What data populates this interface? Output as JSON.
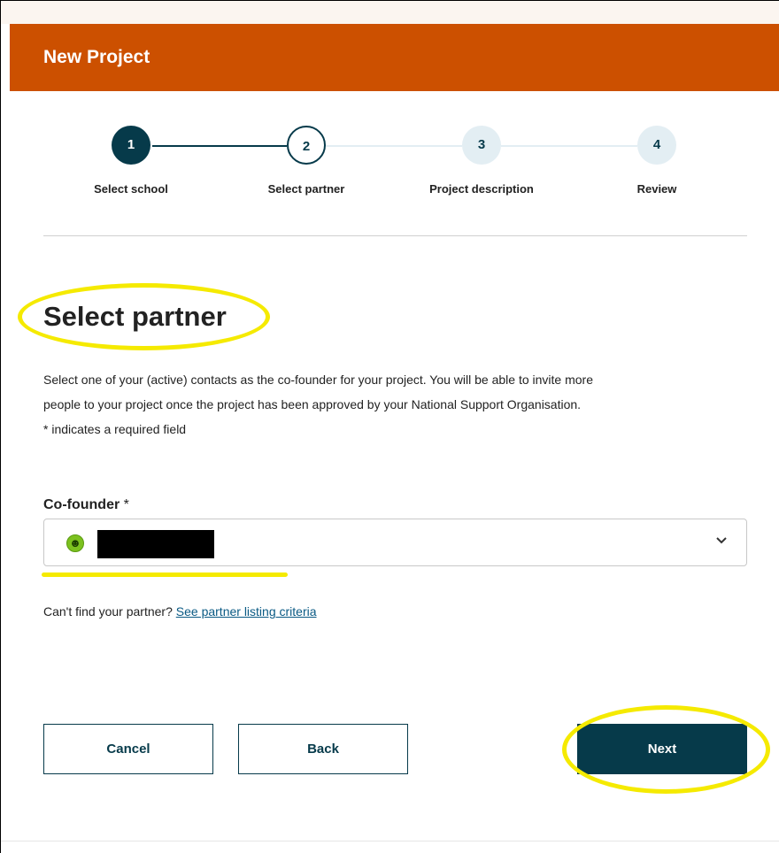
{
  "header": {
    "title": "New Project"
  },
  "stepper": {
    "steps": [
      {
        "number": "1",
        "label": "Select school"
      },
      {
        "number": "2",
        "label": "Select partner"
      },
      {
        "number": "3",
        "label": "Project description"
      },
      {
        "number": "4",
        "label": "Review"
      }
    ],
    "current_step": 2
  },
  "main": {
    "title": "Select partner",
    "description_line1": "Select one of your (active) contacts as the co-founder for your project. You will be able to invite more",
    "description_line2": "people to your project once the project has been approved by your National Support Organisation.",
    "required_note": "* indicates a required field"
  },
  "cofounder_field": {
    "label": "Co-founder",
    "required_marker": "*",
    "avatar_icon": "smiley-avatar-icon",
    "selected_value": "[redacted]",
    "chevron_icon": "chevron-down-icon"
  },
  "help": {
    "text": "Can't find your partner?",
    "link_label": "See partner listing criteria"
  },
  "buttons": {
    "cancel": "Cancel",
    "back": "Back",
    "next": "Next"
  },
  "colors": {
    "header_bg": "#cc5000",
    "primary": "#063a4a",
    "highlight": "#f5ea00",
    "link": "#0a5a84"
  }
}
